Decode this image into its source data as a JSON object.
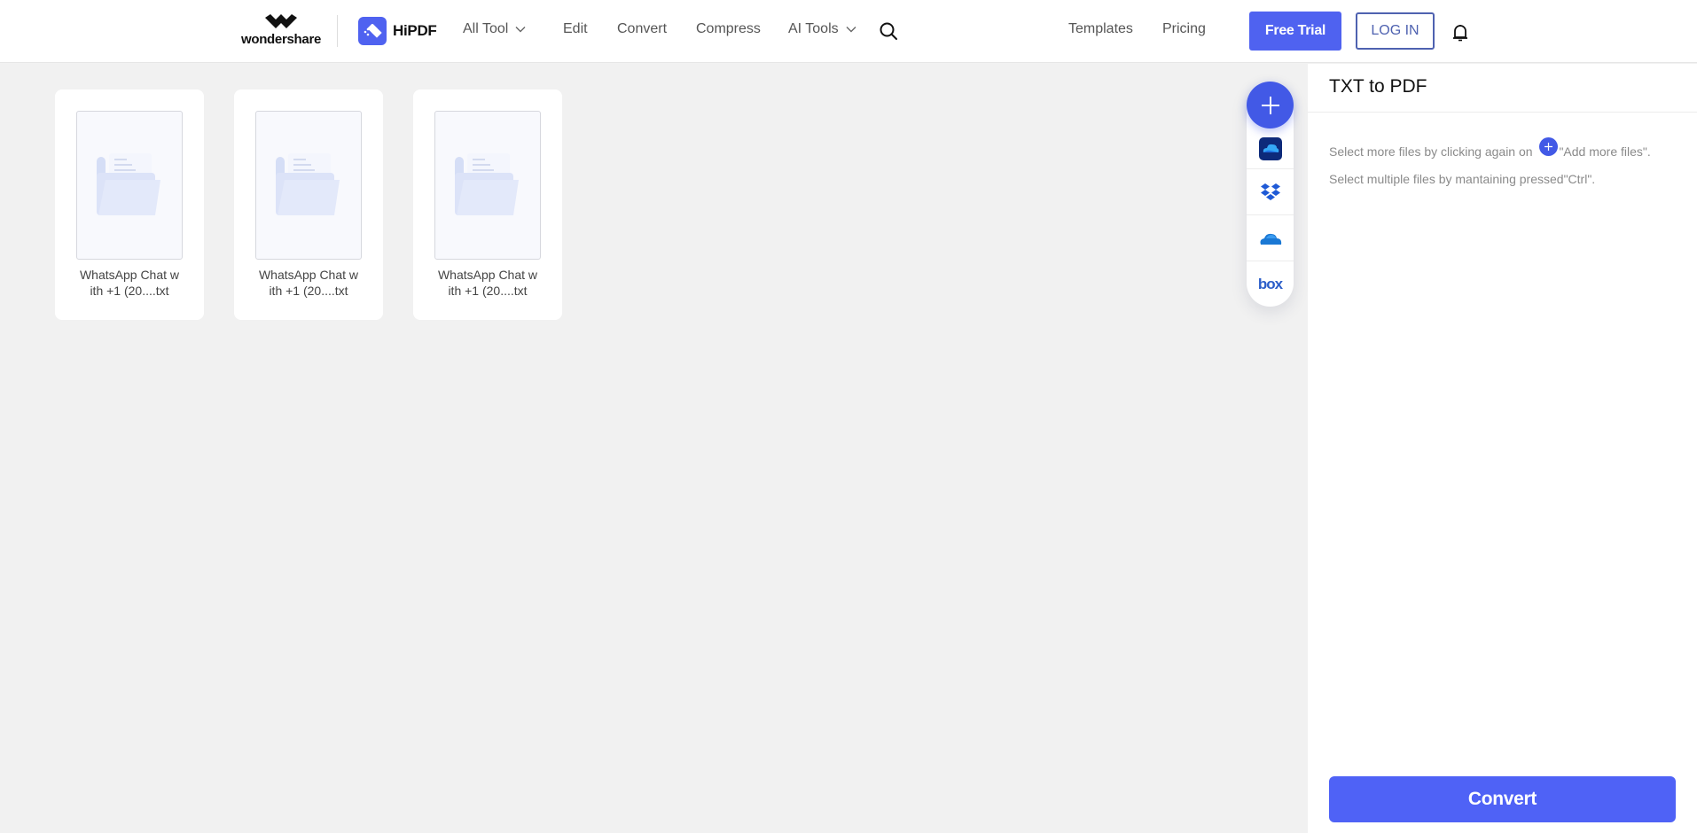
{
  "header": {
    "brand": "wondershare",
    "product": "HiPDF",
    "nav": [
      {
        "label": "All Tool",
        "has_dropdown": true
      },
      {
        "label": "Edit",
        "has_dropdown": false
      },
      {
        "label": "Convert",
        "has_dropdown": false
      },
      {
        "label": "Compress",
        "has_dropdown": false
      },
      {
        "label": "AI Tools",
        "has_dropdown": true
      }
    ],
    "right_nav": [
      {
        "label": "Templates"
      },
      {
        "label": "Pricing"
      }
    ],
    "free_trial_label": "Free Trial",
    "login_label": "LOG IN",
    "icons": {
      "search": "search-icon",
      "notifications": "bell-icon"
    }
  },
  "files": [
    {
      "name_line1": "WhatsApp Chat w",
      "name_line2": "ith +1 (20....txt",
      "icon": "folder-document-icon"
    },
    {
      "name_line1": "WhatsApp Chat w",
      "name_line2": "ith +1 (20....txt",
      "icon": "folder-document-icon"
    },
    {
      "name_line1": "WhatsApp Chat w",
      "name_line2": "ith +1 (20....txt",
      "icon": "folder-document-icon"
    }
  ],
  "sources": [
    {
      "name": "Add more files",
      "icon": "plus-icon"
    },
    {
      "name": "Wondershare Cloud",
      "icon": "wondershare-cloud-icon"
    },
    {
      "name": "Dropbox",
      "icon": "dropbox-icon"
    },
    {
      "name": "OneDrive",
      "icon": "onedrive-icon"
    },
    {
      "name": "Box",
      "icon": "box-icon",
      "text": "box"
    }
  ],
  "panel": {
    "title": "TXT to PDF",
    "hint1_before": "Select more files by clicking again on ",
    "hint1_after": "\"Add more files\".",
    "hint2": "Select multiple files by mantaining pressed\"Ctrl\".",
    "convert_label": "Convert"
  },
  "colors": {
    "accent": "#4f62f0",
    "page_bg": "#f1f1f1",
    "login_border": "#4f62b0"
  }
}
